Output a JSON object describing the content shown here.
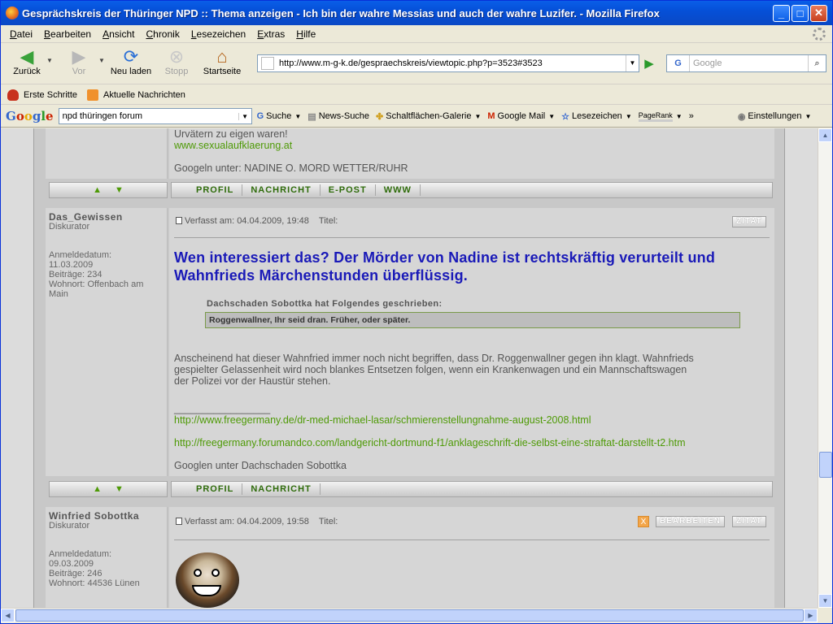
{
  "window": {
    "title": "Gesprächskreis der Thüringer NPD :: Thema anzeigen - Ich bin der wahre Messias und auch der wahre Luzifer. - Mozilla Firefox",
    "minimize": "_",
    "maximize": "□",
    "close": "✕"
  },
  "menu": [
    "Datei",
    "Bearbeiten",
    "Ansicht",
    "Chronik",
    "Lesezeichen",
    "Extras",
    "Hilfe"
  ],
  "nav": {
    "back": "Zurück",
    "forward": "Vor",
    "reload": "Neu laden",
    "stop": "Stopp",
    "home": "Startseite",
    "url": "http://www.m-g-k.de/gespraechskreis/viewtopic.php?p=3523#3523",
    "search_engine": "G",
    "search_placeholder": "Google"
  },
  "bookmarks": [
    "Erste Schritte",
    "Aktuelle Nachrichten"
  ],
  "googlebar": {
    "logo": "Google",
    "query": "npd thüringen forum",
    "items": [
      "Suche",
      "News-Suche",
      "Schaltflächen-Galerie",
      "Google Mail",
      "Lesezeichen",
      "PageRank",
      "»",
      "Einstellungen"
    ]
  },
  "prev_post": {
    "line1": "Urvätern zu eigen waren!",
    "link": "www.sexualaufklaerung.at",
    "sig": "Googeln unter: NADINE O. MORD WETTER/RUHR",
    "actions": [
      "PROFIL",
      "NACHRICHT",
      "E-POST",
      "WWW"
    ]
  },
  "arrows": {
    "up": "▲",
    "down": "▼"
  },
  "post1": {
    "author": "Das_Gewissen",
    "rank": "Diskurator",
    "info": [
      "Anmeldedatum:",
      "11.03.2009",
      "Beiträge: 234",
      "Wohnort: Offenbach am",
      "Main"
    ],
    "meta": "Verfasst am: 04.04.2009, 19:48    Titel:",
    "quote_btn": "ZITAT",
    "headline": "Wen interessiert das? Der Mörder von Nadine ist rechtskräftig verurteilt und Wahnfrieds Märchenstunden überflüssig.",
    "quote_author": "Dachschaden Sobottka hat Folgendes geschrieben:",
    "quote_text": "Roggenwallner, Ihr seid dran. Früher, oder später.",
    "body": [
      "Anscheinend hat dieser Wahnfried immer noch nicht begriffen, dass Dr. Roggenwallner gegen ihn klagt. Wahnfrieds",
      "gespielter Gelassenheit wird noch blankes Entsetzen folgen, wenn ein Krankenwagen und ein Mannschaftswagen",
      "der Polizei vor der Haustür stehen."
    ],
    "sig_line": "_________________",
    "link1": "http://www.freegermany.de/dr-med-michael-lasar/schmierenstellungnahme-august-2008.html",
    "link2": "http://freegermany.forumandco.com/landgericht-dortmund-f1/anklageschrift-die-selbst-eine-straftat-darstellt-t2.htm",
    "sig": "Googlen unter Dachschaden Sobottka",
    "actions": [
      "PROFIL",
      "NACHRICHT"
    ]
  },
  "post2": {
    "author": "Winfried Sobottka",
    "rank": "Diskurator",
    "info": [
      "Anmeldedatum:",
      "09.03.2009",
      "Beiträge: 246",
      "Wohnort: 44536 Lünen"
    ],
    "meta": "Verfasst am: 04.04.2009, 19:58    Titel:",
    "delete": "X",
    "edit_btn": "BEARBEITEN",
    "quote_btn": "ZITAT"
  },
  "colors": {
    "titlebar": "#0a5ee8",
    "link": "#4e9a06",
    "headline": "#1a1ab8"
  },
  "icons": [
    "firefox-icon",
    "back-arrow-icon",
    "forward-arrow-icon",
    "reload-icon",
    "stop-icon",
    "home-icon",
    "go-arrow-icon",
    "search-icon",
    "bookmark-icon",
    "rss-icon",
    "post-icon",
    "avatar-image"
  ]
}
